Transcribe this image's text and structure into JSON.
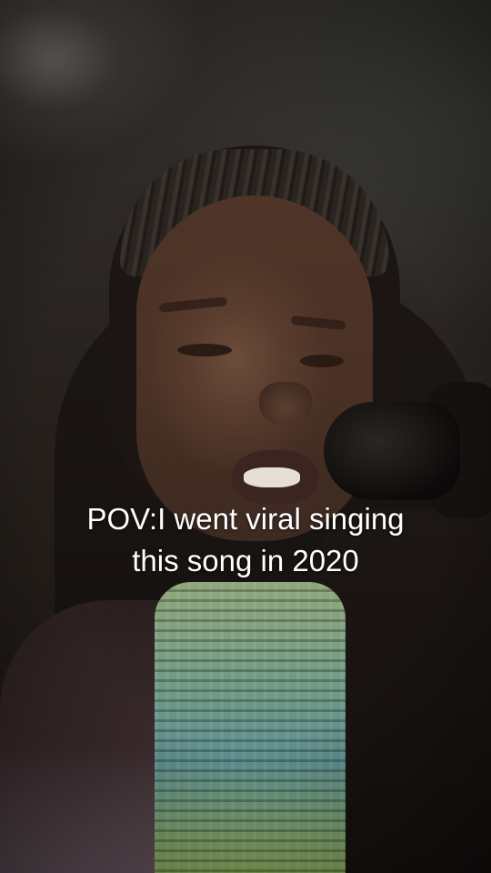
{
  "caption": {
    "line1": "POV:I went viral singing",
    "line2": "this song in 2020"
  }
}
